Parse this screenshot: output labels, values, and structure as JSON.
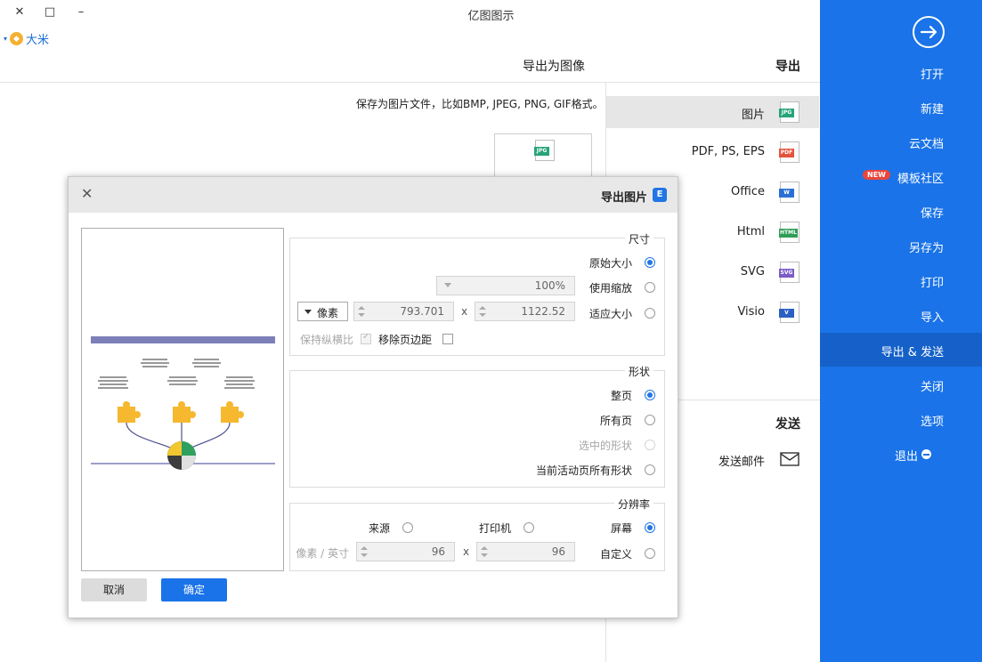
{
  "window": {
    "title": "亿图图示",
    "minimize_glyph": "–",
    "maximize_glyph": "□",
    "close_glyph": "✕"
  },
  "user": {
    "name": "大米",
    "caret": "▾",
    "vip_icon": "vip-diamond-icon"
  },
  "main": {
    "section_header": "导出为图像",
    "description": "保存为图片文件，比如BMP, JPEG, PNG, GIF格式。",
    "preview_tag": "JPG"
  },
  "export_panel": {
    "header": "导出",
    "formats": [
      {
        "label": "图片",
        "tag": "JPG",
        "color": "#27a37a"
      },
      {
        "label": "PDF, PS, EPS",
        "tag": "PDF",
        "color": "#e5533d"
      },
      {
        "label": "Office",
        "tag": "W",
        "color": "#2b6fd6"
      },
      {
        "label": "Html",
        "tag": "HTML",
        "color": "#2e9e56"
      },
      {
        "label": "SVG",
        "tag": "SVG",
        "color": "#7a5cc6"
      },
      {
        "label": "Visio",
        "tag": "V",
        "color": "#2b5fc2"
      }
    ],
    "send_header": "发送",
    "send_item": "发送邮件"
  },
  "sidebar": {
    "back_icon": "arrow-right-circle-icon",
    "items": [
      {
        "label": "打开"
      },
      {
        "label": "新建"
      },
      {
        "label": "云文档"
      },
      {
        "label": "模板社区",
        "badge": "NEW"
      },
      {
        "label": "保存"
      },
      {
        "label": "另存为"
      },
      {
        "label": "打印"
      },
      {
        "label": "导入"
      },
      {
        "label": "导出 & 发送"
      },
      {
        "label": "关闭"
      },
      {
        "label": "选项"
      },
      {
        "label": "退出"
      }
    ],
    "selected_index": 8
  },
  "dialog": {
    "title": "导出图片",
    "close_glyph": "✕",
    "logo_glyph": "E",
    "size_group": {
      "title": "尺寸",
      "original_size": "原始大小",
      "use_zoom": "使用缩放",
      "zoom_value": "100%",
      "fit_size": "适应大小",
      "width": "1122.52",
      "times": "x",
      "height": "793.701",
      "unit": "像素",
      "remove_margin": "移除页边距",
      "keep_ratio": "保持纵横比"
    },
    "shape_group": {
      "title": "形状",
      "whole_page": "整页",
      "all_pages": "所有页",
      "selected_shapes": "选中的形状",
      "current_page_all": "当前活动页所有形状"
    },
    "resolution_group": {
      "title": "分辨率",
      "screen": "屏幕",
      "printer": "打印机",
      "source": "来源",
      "custom": "自定义",
      "dpi_x": "96",
      "times": "x",
      "dpi_y": "96",
      "unit": "像素 / 英寸"
    },
    "ok": "确定",
    "cancel": "取消"
  },
  "colors": {
    "sidebar": "#1a73e8",
    "sidebar_selected": "#1561c9",
    "accent": "#2276e3",
    "new_badge": "#e9453b"
  }
}
